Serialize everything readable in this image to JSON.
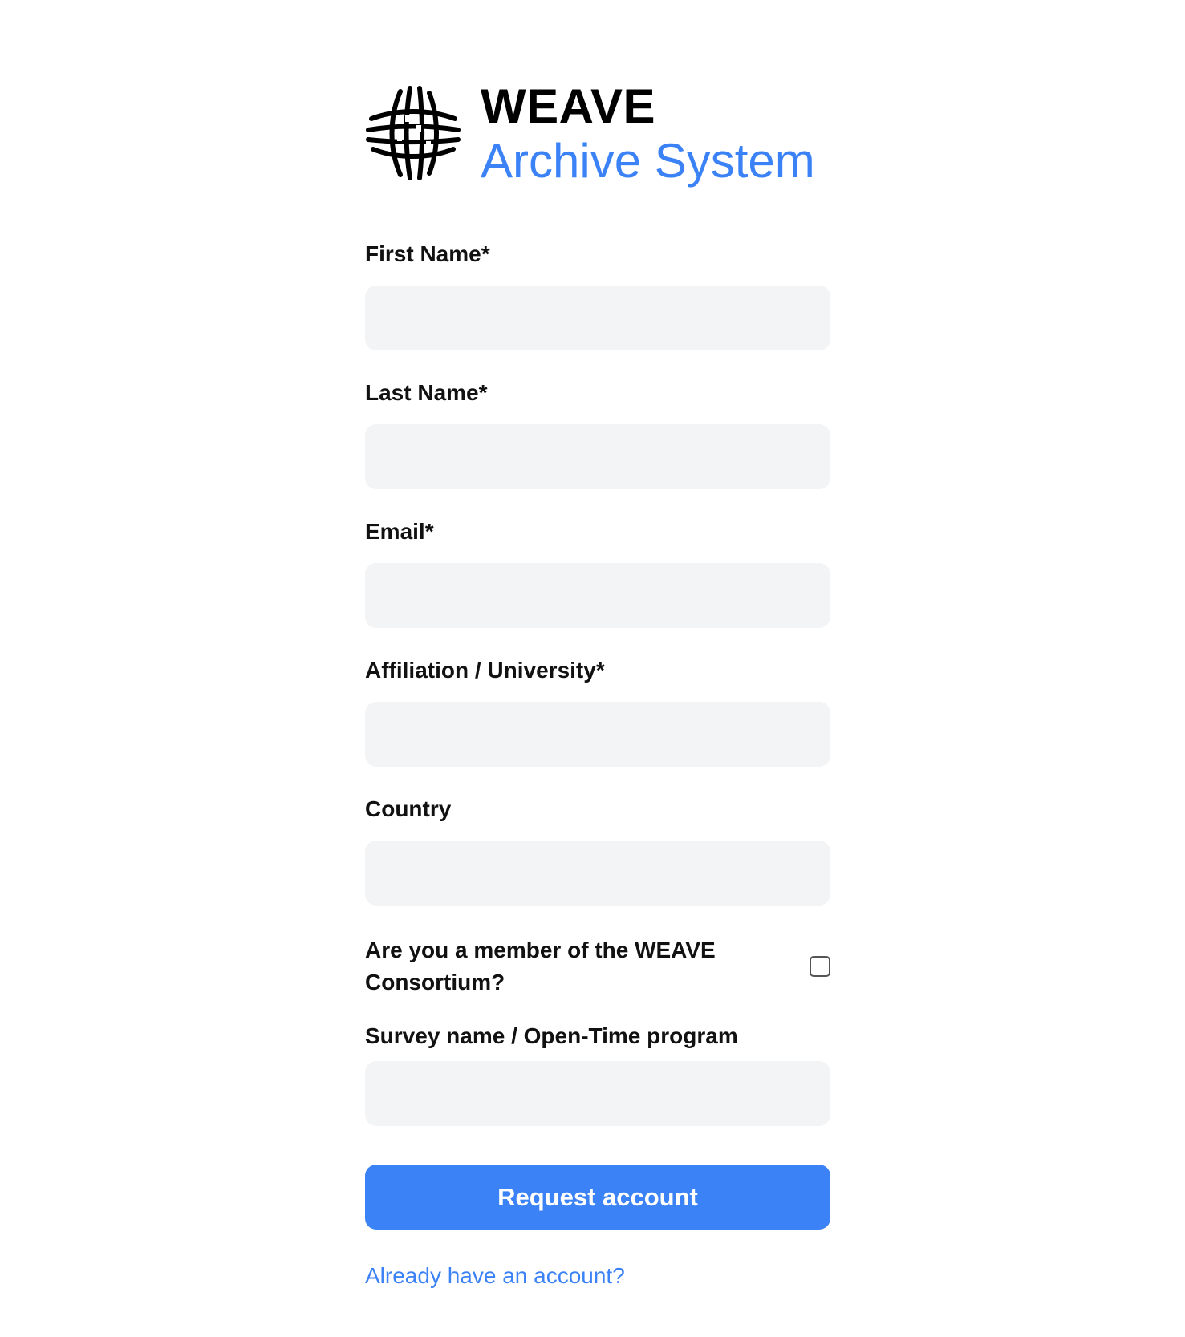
{
  "brand": {
    "title": "WEAVE",
    "subtitle": "Archive System",
    "logo_icon": "weave-logo-icon"
  },
  "colors": {
    "accent": "#3b82f6",
    "input_background": "#f3f4f6",
    "text": "#111111"
  },
  "form": {
    "fields": [
      {
        "label": "First Name*",
        "value": "",
        "placeholder": ""
      },
      {
        "label": "Last Name*",
        "value": "",
        "placeholder": ""
      },
      {
        "label": "Email*",
        "value": "",
        "placeholder": ""
      },
      {
        "label": "Affiliation / University*",
        "value": "",
        "placeholder": ""
      },
      {
        "label": "Country",
        "value": "",
        "placeholder": ""
      }
    ],
    "consortium": {
      "label": "Are you a member of the WEAVE Consortium?",
      "checked": false
    },
    "survey": {
      "label": "Survey name / Open-Time program",
      "value": "",
      "placeholder": ""
    },
    "submit_label": "Request account",
    "login_link_label": "Already have an account?"
  }
}
